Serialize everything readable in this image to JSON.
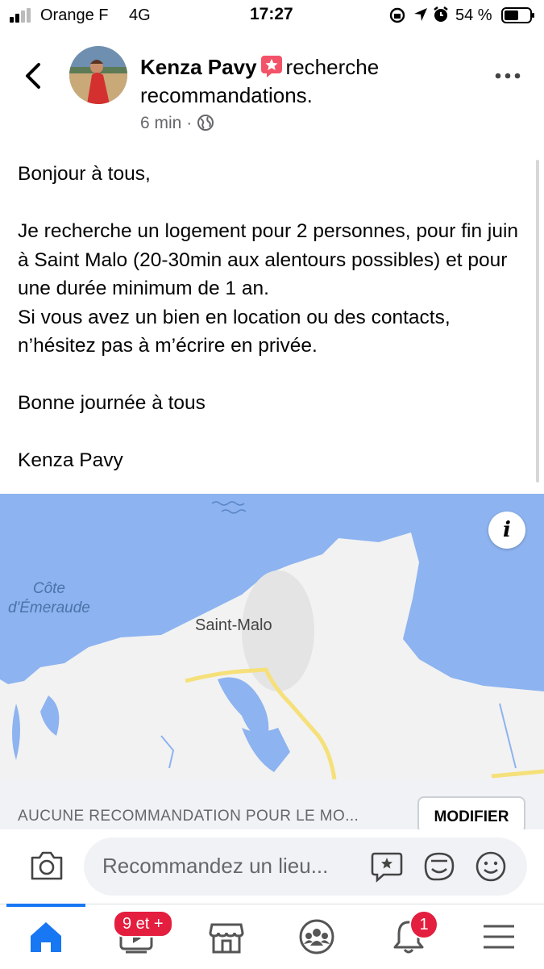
{
  "status_bar": {
    "carrier": "Orange F",
    "network": "4G",
    "time": "17:27",
    "battery": "54 %"
  },
  "post": {
    "author": "Kenza Pavy",
    "action": "recherche recommandations.",
    "time_ago": "6 min",
    "separator": "·",
    "body": "Bonjour à tous,\n\nJe recherche un logement pour 2 personnes, pour fin juin à Saint Malo (20-30min aux alentours possibles) et pour une durée minimum de 1 an.\nSi vous avez un bien en location ou des contacts, n’hésitez pas à m’écrire en privée.\n\nBonne journée à tous\n\nKenza Pavy"
  },
  "map": {
    "label_cote": "Côte\nd'Émeraude",
    "label_city": "Saint-Malo",
    "info_glyph": "i",
    "water_color": "#8db3f0",
    "land_color": "#f2f2f2",
    "road_color": "#f5e07a"
  },
  "recommendations": {
    "status_text": "AUCUNE RECOMMANDATION POUR LE MO...",
    "modify_label": "MODIFIER"
  },
  "composer": {
    "placeholder": "Recommandez un lieu..."
  },
  "nav": {
    "video_badge": "9 et +",
    "notifications_badge": "1",
    "accent": "#1877f2",
    "badge_color": "#e41e3f"
  }
}
